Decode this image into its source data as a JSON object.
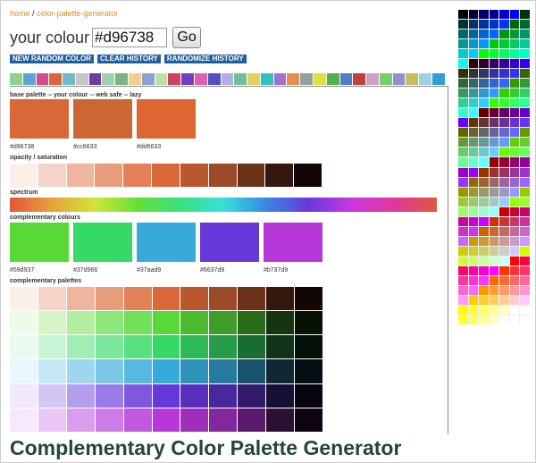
{
  "breadcrumb": {
    "home": "home",
    "separator": " / ",
    "current": "color-palette-generator"
  },
  "colour_form": {
    "label": "your colour",
    "value": "#d96738",
    "go_label": "Go"
  },
  "buttons": {
    "new_random": "NEW RANDOM COLOR",
    "clear_history": "CLEAR HISTORY",
    "randomize_history": "RANDOMIZE HISTORY"
  },
  "history_swatches": [
    "#8fcf8f",
    "#5fa4d4",
    "#d34c8a",
    "#d96738",
    "#6fb9c9",
    "#c6c6c6",
    "#6a3fa0",
    "#9fd0b0",
    "#7fb07f",
    "#f0d090",
    "#8fa0d0",
    "#bfe0a0",
    "#d04060",
    "#7040c0",
    "#e060b0",
    "#5050c0",
    "#b0b0e0",
    "#70c0a0",
    "#e0d060",
    "#30c0c0",
    "#a070d0",
    "#e09050",
    "#90a0a0",
    "#e0e040",
    "#50b050",
    "#5080c0",
    "#c04040",
    "#d0a0c0",
    "#70d070",
    "#9090d0",
    "#c0c060",
    "#a0d0e0",
    "#30a0d0"
  ],
  "sections": {
    "base": "base palette -- your colour -- web safe -- lazy",
    "opacity": "opacity / saturation",
    "spectrum": "spectrum",
    "complementary_colours": "complementary colours",
    "complementary_palettes": "complementary palettes"
  },
  "base_swatches": [
    {
      "hex": "#d96738",
      "color": "#d96738"
    },
    {
      "hex": "#cc6633",
      "color": "#cc6633"
    },
    {
      "hex": "#dd6633",
      "color": "#dd6633"
    }
  ],
  "opacity_swatches": [
    "#fbefe9",
    "#f4d4c6",
    "#eeb69e",
    "#e79d7b",
    "#e38158",
    "#d96738",
    "#ba5730",
    "#9d4a28",
    "#6c3219",
    "#341810",
    "#120705"
  ],
  "complementary": [
    {
      "hex": "#59d937",
      "color": "#59d937"
    },
    {
      "hex": "#37d966",
      "color": "#37d966"
    },
    {
      "hex": "#37aad9",
      "color": "#37aad9"
    },
    {
      "hex": "#6637d9",
      "color": "#6637d9"
    },
    {
      "hex": "#b737d9",
      "color": "#b737d9"
    }
  ],
  "palette_rows": [
    [
      "#fbefe9",
      "#f4d4c6",
      "#eeb69e",
      "#e79d7b",
      "#e38158",
      "#d96738",
      "#ba5730",
      "#9d4a28",
      "#6c3219",
      "#341810",
      "#120705"
    ],
    [
      "#eefbe9",
      "#d6f4c6",
      "#b5ee9e",
      "#8ee77b",
      "#72e058",
      "#59d937",
      "#4bba2f",
      "#3e9d27",
      "#2b6c19",
      "#153410",
      "#071205"
    ],
    [
      "#e9fbef",
      "#c6f4d4",
      "#9eeeb6",
      "#7be79d",
      "#58e081",
      "#37d966",
      "#2fba57",
      "#279d4a",
      "#196c32",
      "#103418",
      "#051207"
    ],
    [
      "#e9f6fb",
      "#c6e8f4",
      "#9ed6ee",
      "#7bc8e7",
      "#58b8e0",
      "#37aad9",
      "#2f92ba",
      "#277b9d",
      "#19546c",
      "#102834",
      "#050e12"
    ],
    [
      "#efe9fb",
      "#d4c6f4",
      "#b49eee",
      "#9b7be7",
      "#8058e0",
      "#6637d9",
      "#572fba",
      "#49279d",
      "#31196c",
      "#181034",
      "#070512"
    ],
    [
      "#f7e9fb",
      "#eac6f4",
      "#da9eee",
      "#cd7be7",
      "#c158e0",
      "#b737d9",
      "#9d2fba",
      "#84279d",
      "#5b196c",
      "#2c1034",
      "#0f0512"
    ]
  ],
  "side_palette": [
    [
      "#000000",
      "#000033",
      "#000066",
      "#000099",
      "#0000cc",
      "#0000ff",
      "#003300"
    ],
    [
      "#003333",
      "#003366",
      "#003399",
      "#0033cc",
      "#0033ff",
      "#006600",
      "#006633"
    ],
    [
      "#006666",
      "#006699",
      "#0066cc",
      "#0066ff",
      "#009900",
      "#009933",
      "#009966"
    ],
    [
      "#009999",
      "#0099cc",
      "#0099ff",
      "#00cc00",
      "#00cc33",
      "#00cc66",
      "#00cc99"
    ],
    [
      "#00cccc",
      "#00ccff",
      "#00ff00",
      "#00ff33",
      "#00ff66",
      "#00ff99",
      "#00ffcc"
    ],
    [
      "#00ffff",
      "#330000",
      "#330033",
      "#330066",
      "#330099",
      "#3300cc",
      "#3300ff"
    ],
    [
      "#333300",
      "#333333",
      "#333366",
      "#333399",
      "#3333cc",
      "#3333ff",
      "#336600"
    ],
    [
      "#336633",
      "#336666",
      "#336699",
      "#3366cc",
      "#3366ff",
      "#339900",
      "#339933"
    ],
    [
      "#339966",
      "#339999",
      "#3399cc",
      "#3399ff",
      "#33cc00",
      "#33cc33",
      "#33cc66"
    ],
    [
      "#33cc99",
      "#33cccc",
      "#33ccff",
      "#33ff00",
      "#33ff33",
      "#33ff66",
      "#33ff99"
    ],
    [
      "#33ffcc",
      "#33ffff",
      "#660000",
      "#660033",
      "#660066",
      "#660099",
      "#6600cc"
    ],
    [
      "#6600ff",
      "#663300",
      "#663333",
      "#663366",
      "#663399",
      "#6633cc",
      "#6633ff"
    ],
    [
      "#666600",
      "#666633",
      "#666666",
      "#666699",
      "#6666cc",
      "#6666ff",
      "#669900"
    ],
    [
      "#669933",
      "#669966",
      "#669999",
      "#6699cc",
      "#6699ff",
      "#66cc00",
      "#66cc33"
    ],
    [
      "#66cc66",
      "#66cc99",
      "#66cccc",
      "#66ccff",
      "#66ff00",
      "#66ff33",
      "#66ff66"
    ],
    [
      "#66ff99",
      "#66ffcc",
      "#66ffff",
      "#990000",
      "#990033",
      "#990066",
      "#990099"
    ],
    [
      "#9900cc",
      "#9900ff",
      "#993300",
      "#993333",
      "#993366",
      "#993399",
      "#9933cc"
    ],
    [
      "#9933ff",
      "#996600",
      "#996633",
      "#996666",
      "#996699",
      "#9966cc",
      "#9966ff"
    ],
    [
      "#999900",
      "#999933",
      "#999966",
      "#999999",
      "#9999cc",
      "#9999ff",
      "#99cc00"
    ],
    [
      "#99cc33",
      "#99cc66",
      "#99cc99",
      "#99cccc",
      "#99ccff",
      "#99ff00",
      "#99ff33"
    ],
    [
      "#99ff66",
      "#99ff99",
      "#99ffcc",
      "#99ffff",
      "#cc0000",
      "#cc0033",
      "#cc0066"
    ],
    [
      "#cc0099",
      "#cc00cc",
      "#cc00ff",
      "#cc3300",
      "#cc3333",
      "#cc3366",
      "#cc3399"
    ],
    [
      "#cc33cc",
      "#cc33ff",
      "#cc6600",
      "#cc6633",
      "#cc6666",
      "#cc6699",
      "#cc66cc"
    ],
    [
      "#cc66ff",
      "#cc9900",
      "#cc9933",
      "#cc9966",
      "#cc9999",
      "#cc99cc",
      "#cc99ff"
    ],
    [
      "#cccc00",
      "#cccc33",
      "#cccc66",
      "#cccc99",
      "#cccccc",
      "#ccccff",
      "#ccff00"
    ],
    [
      "#ccff33",
      "#ccff66",
      "#ccff99",
      "#ccffcc",
      "#ccffff",
      "#ff0000",
      "#ff0033"
    ],
    [
      "#ff0066",
      "#ff0099",
      "#ff00cc",
      "#ff00ff",
      "#ff3300",
      "#ff3333",
      "#ff3366"
    ],
    [
      "#ff3399",
      "#ff33cc",
      "#ff33ff",
      "#ff6600",
      "#ff6633",
      "#ff6666",
      "#ff6699"
    ],
    [
      "#ff66cc",
      "#ff66ff",
      "#ff9900",
      "#ff9933",
      "#ff9966",
      "#ff9999",
      "#ff99cc"
    ],
    [
      "#ff99ff",
      "#ffcc00",
      "#ffcc33",
      "#ffcc66",
      "#ffcc99",
      "#ffcccc",
      "#ffccff"
    ],
    [
      "#ffff00",
      "#ffff33",
      "#ffff66",
      "#ffff99",
      "#ffffcc",
      "#ffffff",
      "#ffffff"
    ],
    [
      "#ffff33",
      "#ffff66",
      "#ffff99",
      "#ffffcc",
      "#ffffff",
      "#ffffff",
      "#ffffff"
    ]
  ],
  "page_title": "Complementary Color Palette Generator"
}
